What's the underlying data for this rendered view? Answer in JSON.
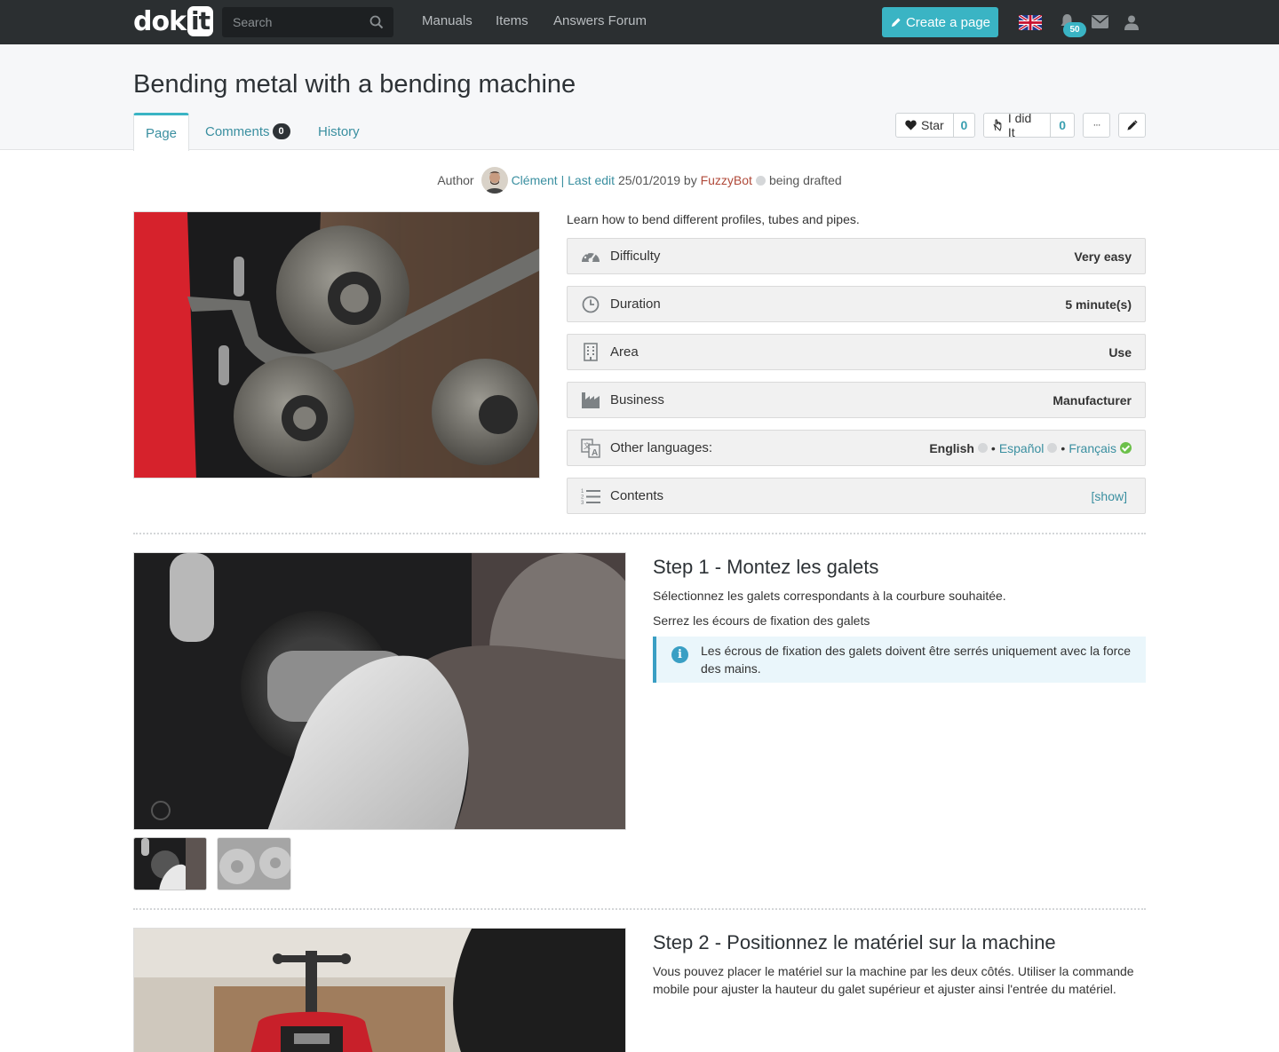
{
  "nav": {
    "logo_dok": "dok",
    "logo_it": "it",
    "search_placeholder": "Search",
    "links": [
      "Manuals",
      "Items",
      "Answers Forum"
    ],
    "create_label": "Create a page",
    "notifications_count": "50"
  },
  "page": {
    "title": "Bending metal with a bending machine",
    "tabs": [
      {
        "label": "Page"
      },
      {
        "label": "Comments",
        "count": "0"
      },
      {
        "label": "History"
      }
    ],
    "star_label": "Star",
    "star_count": "0",
    "did_it_label": "I did It",
    "did_it_count": "0",
    "more_label": "···"
  },
  "author_line": {
    "author_prefix": "Author",
    "author_name": "Clément",
    "separator": " | ",
    "last_edit_label": "Last edit",
    "date": " 25/01/2019 by ",
    "editor": "FuzzyBot",
    "status": "being drafted"
  },
  "summary": {
    "intro": "Learn how to bend different profiles, tubes and pipes.",
    "difficulty_label": "Difficulty",
    "difficulty_value": "Very easy",
    "duration_label": "Duration",
    "duration_value": "5 minute(s)",
    "area_label": "Area",
    "area_value": "Use",
    "business_label": "Business",
    "business_value": "Manufacturer",
    "languages_label": "Other languages:",
    "languages": {
      "english": "English",
      "espanol": "Español",
      "francais": "Français",
      "bullet": "•"
    },
    "contents_label": "Contents",
    "contents_toggle": "[show]"
  },
  "steps": [
    {
      "title": "Step 1 - Montez les galets",
      "paragraphs": [
        "Sélectionnez les galets correspondants à la courbure souhaitée.",
        "Serrez les écours de fixation des galets"
      ],
      "note": "Les écrous de fixation des galets doivent être serrés uniquement avec la force des mains."
    },
    {
      "title": "Step 2 - Positionnez le matériel sur la machine",
      "paragraphs": [
        "Vous pouvez placer le matériel sur la machine par les deux côtés. Utiliser la commande mobile pour ajuster la hauteur du galet supérieur et ajuster ainsi l'entrée du matériel."
      ]
    }
  ],
  "colors": {
    "navbar": "#2b2f31",
    "accent": "#3ab4c4",
    "link": "#3a8fa0",
    "editor_link": "#b04a3a",
    "success": "#6cc04a"
  },
  "icons": [
    "search-icon",
    "pencil-icon",
    "uk-flag-icon",
    "bell-icon",
    "mail-icon",
    "user-icon",
    "heart-icon",
    "hand-icon",
    "edit-icon",
    "gauge-icon",
    "clock-icon",
    "building-icon",
    "factory-icon",
    "translate-icon",
    "list-icon",
    "info-icon"
  ]
}
